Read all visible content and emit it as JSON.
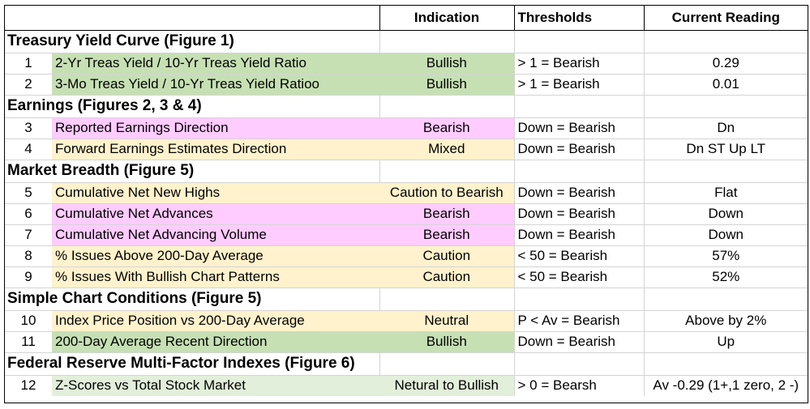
{
  "header": {
    "col_label": "",
    "indication": "Indication",
    "thresholds": "Thresholds",
    "current_reading": "Current Reading"
  },
  "colors": {
    "bullish": "#c6e0b4",
    "bearish": "#ffccff",
    "caution": "#fff2cc",
    "neutral_to_bullish": "#e2efda"
  },
  "sections": [
    {
      "title": "Treasury Yield Curve (Figure 1)",
      "rows": [
        {
          "num": "1",
          "label": "2-Yr Treas Yield / 10-Yr Treas Yield Ratio",
          "indication": "Bullish",
          "threshold": "> 1 = Bearish",
          "reading": "0.29",
          "fill": "green"
        },
        {
          "num": "2",
          "label": "3-Mo Treas Yield / 10-Yr Treas Yield Ratioo",
          "indication": "Bullish",
          "threshold": "> 1 = Bearish",
          "reading": "0.01",
          "fill": "green"
        }
      ]
    },
    {
      "title": "Earnings (Figures 2, 3 & 4)",
      "rows": [
        {
          "num": "3",
          "label": "Reported Earnings Direction",
          "indication": "Bearish",
          "threshold": "Down = Bearish",
          "reading": "Dn",
          "fill": "pink"
        },
        {
          "num": "4",
          "label": "Forward Earnings Estimates Direction",
          "indication": "Mixed",
          "threshold": "Down = Bearish",
          "reading": "Dn ST Up LT",
          "fill": "tan"
        }
      ]
    },
    {
      "title": "Market Breadth (Figure 5)",
      "rows": [
        {
          "num": "5",
          "label": "Cumulative Net New Highs",
          "indication": "Caution to Bearish",
          "threshold": "Down = Bearish",
          "reading": "Flat",
          "fill": "tan"
        },
        {
          "num": "6",
          "label": "Cumulative Net Advances",
          "indication": "Bearish",
          "threshold": "Down = Bearish",
          "reading": "Down",
          "fill": "pink"
        },
        {
          "num": "7",
          "label": "Cumulative Net Advancing Volume",
          "indication": "Bearish",
          "threshold": "Down = Bearish",
          "reading": "Down",
          "fill": "pink"
        },
        {
          "num": "8",
          "label": "% Issues Above 200-Day Average",
          "indication": "Caution",
          "threshold": "< 50 = Bearish",
          "reading": "57%",
          "fill": "tan"
        },
        {
          "num": "9",
          "label": "% Issues With Bullish Chart Patterns",
          "indication": "Caution",
          "threshold": "< 50 = Bearish",
          "reading": "52%",
          "fill": "tan"
        }
      ]
    },
    {
      "title": "Simple Chart Conditions (Figure 5)",
      "rows": [
        {
          "num": "10",
          "label": "Index Price Position vs 200-Day Average",
          "indication": "Neutral",
          "threshold": "P < Av = Bearish",
          "reading": "Above by 2%",
          "fill": "tan"
        },
        {
          "num": "11",
          "label": "200-Day Average Recent Direction",
          "indication": "Bullish",
          "threshold": "Down = Bearish",
          "reading": "Up",
          "fill": "green"
        }
      ]
    },
    {
      "title": "Federal Reserve Multi-Factor Indexes (Figure 6)",
      "rows": [
        {
          "num": "12",
          "label": "Z-Scores vs Total Stock Market",
          "indication": "Netural to Bullish",
          "threshold": "> 0 = Bearsh",
          "reading": "Av -0.29 (1+,1 zero, 2 -)",
          "fill": "lgreen"
        }
      ]
    }
  ]
}
